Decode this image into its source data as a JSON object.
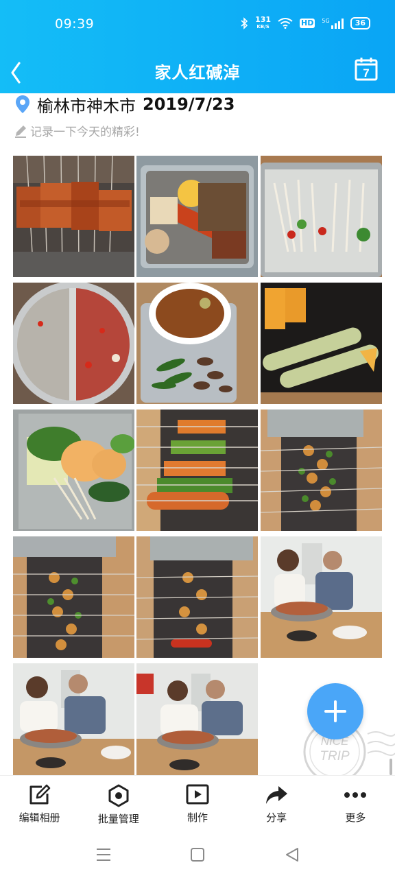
{
  "status_bar": {
    "time": "09:39",
    "network_speed": "131",
    "network_speed_unit": "KB/S",
    "hd_label": "HD",
    "signal_label": "5G",
    "battery": "36",
    "icons": [
      "bluetooth-icon",
      "wifi-icon",
      "signal-icon",
      "battery-icon"
    ]
  },
  "app_bar": {
    "title": "家人红碱淖",
    "calendar_day": "7",
    "back_icon": "chevron-left-icon",
    "calendar_icon": "calendar-icon"
  },
  "location": {
    "place": "榆林市神木市",
    "date": "2019/7/23",
    "icon": "location-pin-icon"
  },
  "note": {
    "placeholder": "记录一下今天的精彩!",
    "icon": "pencil-icon"
  },
  "photos": [
    {
      "name": "grilled-skewers"
    },
    {
      "name": "bbq-platter"
    },
    {
      "name": "enoki-mushrooms"
    },
    {
      "name": "hotpot-broth"
    },
    {
      "name": "bowl-and-beans"
    },
    {
      "name": "crackers-and-rolls"
    },
    {
      "name": "vegetable-plate"
    },
    {
      "name": "grill-skewers-closeup"
    },
    {
      "name": "grill-table-1"
    },
    {
      "name": "grill-table-2"
    },
    {
      "name": "grill-table-3"
    },
    {
      "name": "family-dinner-1"
    },
    {
      "name": "family-dinner-2"
    },
    {
      "name": "family-dinner-3"
    }
  ],
  "stamp_text": [
    "NICE",
    "TRIP"
  ],
  "bottom_actions": [
    {
      "label": "编辑相册",
      "icon": "edit-icon"
    },
    {
      "label": "批量管理",
      "icon": "hexagon-icon"
    },
    {
      "label": "制作",
      "icon": "play-icon"
    },
    {
      "label": "分享",
      "icon": "share-icon"
    },
    {
      "label": "更多",
      "icon": "more-icon"
    }
  ],
  "nav_bar": [
    "menu-icon",
    "home-icon",
    "back-icon"
  ],
  "colors": {
    "header_start": "#14bdf7",
    "header_end": "#0aa5f5",
    "fab": "#4aa6f8",
    "location_icon": "#2f8af5"
  }
}
